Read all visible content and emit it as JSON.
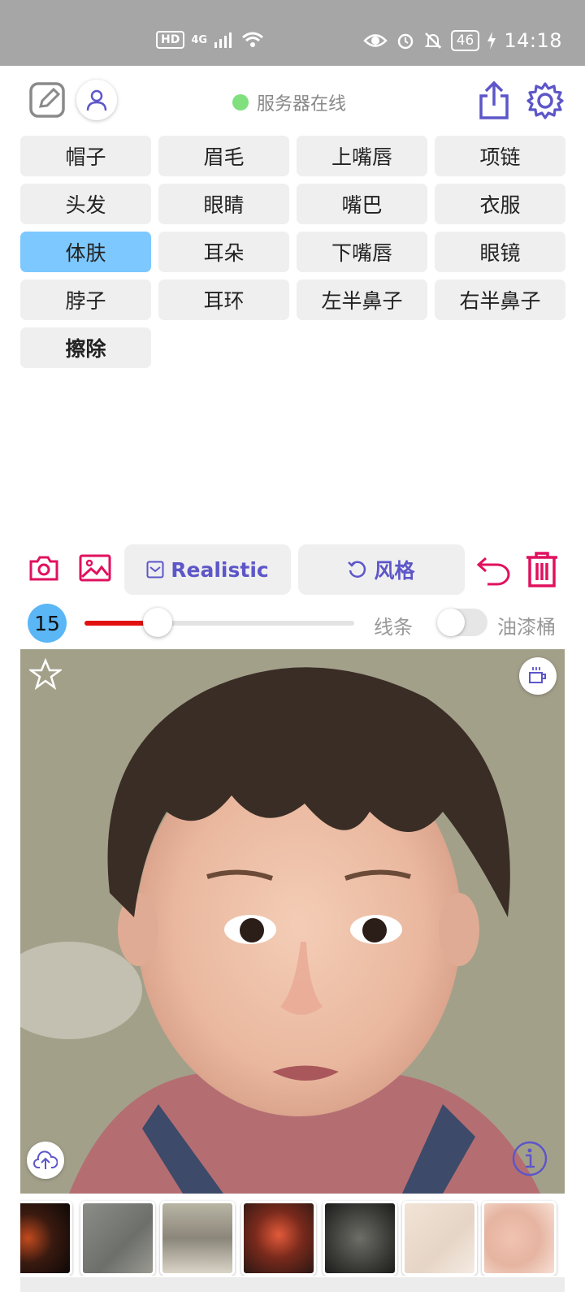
{
  "status_bar": {
    "left_badges": [
      "HD",
      "4G"
    ],
    "battery": "46",
    "time": "14:18"
  },
  "header": {
    "server_status": "服务器在线",
    "server_status_color": "#7fe07d"
  },
  "parts": [
    {
      "label": "帽子"
    },
    {
      "label": "眉毛"
    },
    {
      "label": "上嘴唇"
    },
    {
      "label": "项链"
    },
    {
      "label": "头发"
    },
    {
      "label": "眼睛"
    },
    {
      "label": "嘴巴"
    },
    {
      "label": "衣服"
    },
    {
      "label": "体肤",
      "selected": true
    },
    {
      "label": "耳朵"
    },
    {
      "label": "下嘴唇"
    },
    {
      "label": "眼镜"
    },
    {
      "label": "脖子"
    },
    {
      "label": "耳环"
    },
    {
      "label": "左半鼻子"
    },
    {
      "label": "右半鼻子"
    },
    {
      "label": "擦除"
    }
  ],
  "tools": {
    "model_button": "Realistic",
    "style_button": "风格"
  },
  "brush": {
    "size": "15",
    "slider_fraction": 0.27,
    "line_label": "线条",
    "bucket_label": "油漆桶",
    "bucket_toggle_on": false
  },
  "colors": {
    "accent": "#5d56c8",
    "danger": "#e0115f",
    "selected_chip": "#7cc8ff",
    "slider_fill": "#e31010"
  },
  "thumbnails": [
    {
      "name": "texture-dark-fire"
    },
    {
      "name": "texture-gray-stone"
    },
    {
      "name": "texture-paper-gray"
    },
    {
      "name": "texture-red-ember"
    },
    {
      "name": "texture-gray-bark"
    },
    {
      "name": "texture-cream"
    },
    {
      "name": "texture-skin-blur"
    }
  ]
}
